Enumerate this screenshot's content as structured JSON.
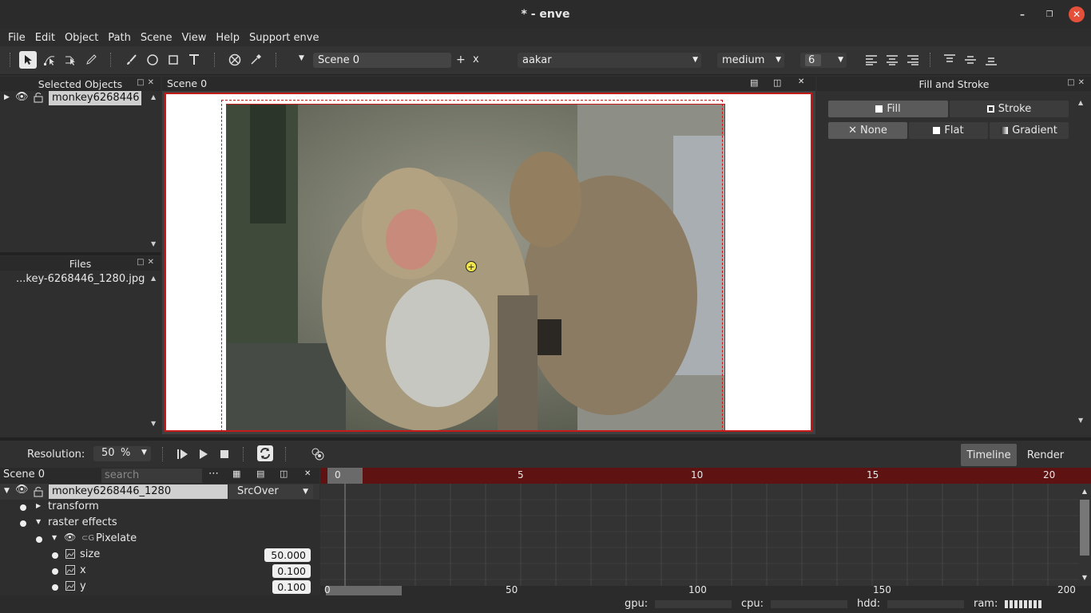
{
  "window": {
    "title": "* - enve"
  },
  "menu": [
    "File",
    "Edit",
    "Object",
    "Path",
    "Scene",
    "View",
    "Help",
    "Support enve"
  ],
  "toolbar": {
    "scene_select": "Scene 0",
    "add": "+",
    "remove": "x",
    "font": "aakar",
    "weight": "medium",
    "font_size": "6"
  },
  "selected_objects": {
    "title": "Selected Objects",
    "item": "monkey6268446"
  },
  "files": {
    "title": "Files",
    "item": "...key-6268446_1280.jpg"
  },
  "canvas": {
    "tab": "Scene 0"
  },
  "fill_stroke": {
    "title": "Fill and Stroke",
    "fill": "Fill",
    "stroke": "Stroke",
    "none": "None",
    "flat": "Flat",
    "gradient": "Gradient"
  },
  "playback": {
    "resolution_label": "Resolution:",
    "resolution_value": "50",
    "resolution_unit": "%",
    "timeline_tab": "Timeline",
    "render_tab": "Render"
  },
  "timeline": {
    "scene": "Scene 0",
    "search_placeholder": "search",
    "layer": "monkey6268446_1280",
    "blend": "SrcOver",
    "transform": "transform",
    "raster_effects": "raster effects",
    "pixelate": "Pixelate",
    "size_label": "size",
    "size_value": "50.000",
    "x_label": "x",
    "x_value": "0.100",
    "y_label": "y",
    "y_value": "0.100",
    "ruler_top": [
      "0",
      "5",
      "10",
      "15",
      "20"
    ],
    "ruler_bottom": [
      "0",
      "50",
      "100",
      "150",
      "200"
    ],
    "current_frame": 0
  },
  "status": {
    "gpu": "gpu:",
    "cpu": "cpu:",
    "hdd": "hdd:",
    "ram": "ram:",
    "ram_level": 0.5
  },
  "colors": {
    "accent_red": "#c41a1a",
    "ruler_red": "#5e1212",
    "close_button": "#e5503b"
  }
}
